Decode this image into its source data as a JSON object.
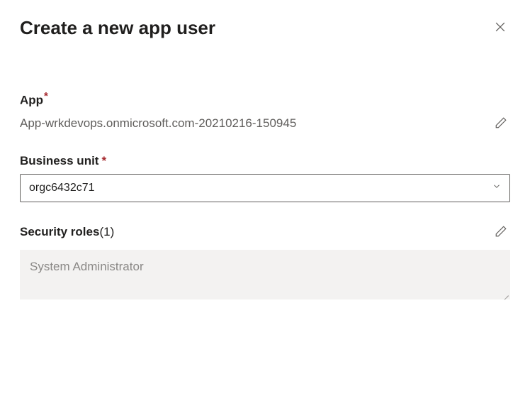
{
  "header": {
    "title": "Create a new app user"
  },
  "app": {
    "label": "App",
    "required_marker": "*",
    "value": "App-wrkdevops.onmicrosoft.com-20210216-150945"
  },
  "business_unit": {
    "label": "Business unit",
    "required_marker": "*",
    "value": "orgc6432c71"
  },
  "security_roles": {
    "label": "Security roles",
    "count_text": "(1)",
    "items": [
      "System Administrator"
    ]
  }
}
